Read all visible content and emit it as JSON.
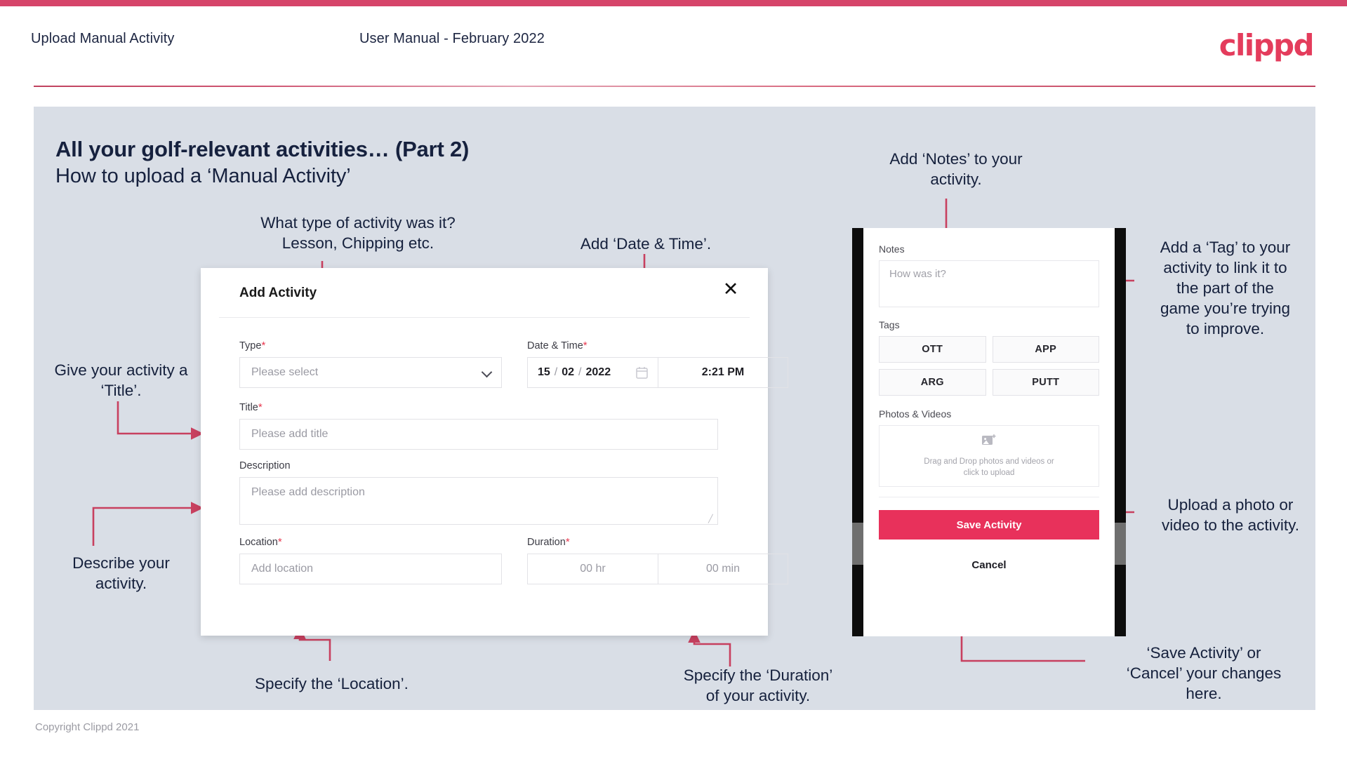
{
  "header": {
    "title": "Upload Manual Activity",
    "subtitle": "User Manual - February 2022",
    "logo": "clippd"
  },
  "slide": {
    "heading": "All your golf-relevant activities… (Part 2)",
    "subheading": "How to upload a ‘Manual Activity’"
  },
  "annotations": {
    "type": "What type of activity was it?\nLesson, Chipping etc.",
    "datetime": "Add ‘Date & Time’.",
    "title": "Give your activity a\n‘Title’.",
    "description": "Describe your\nactivity.",
    "location": "Specify the ‘Location’.",
    "duration": "Specify the ‘Duration’\nof your activity.",
    "notes": "Add ‘Notes’ to your\nactivity.",
    "tag": "Add a ‘Tag’ to your\nactivity to link it to\nthe part of the\ngame you’re trying\nto improve.",
    "upload": "Upload a photo or\nvideo to the activity.",
    "save": "‘Save Activity’ or\n‘Cancel’ your changes\nhere."
  },
  "dialog": {
    "title": "Add Activity",
    "close_icon": "close-icon",
    "type": {
      "label": "Type",
      "required": "*",
      "placeholder": "Please select",
      "chevron_icon": "chevron-down-icon"
    },
    "datetime": {
      "label": "Date & Time",
      "required": "*",
      "day": "15",
      "month": "02",
      "year": "2022",
      "sep": "/",
      "calendar_icon": "calendar-icon",
      "time": "2:21 PM"
    },
    "title_field": {
      "label": "Title",
      "required": "*",
      "placeholder": "Please add title"
    },
    "description": {
      "label": "Description",
      "placeholder": "Please add description"
    },
    "location": {
      "label": "Location",
      "required": "*",
      "placeholder": "Add location"
    },
    "duration": {
      "label": "Duration",
      "required": "*",
      "hours_placeholder": "00 hr",
      "minutes_placeholder": "00 min"
    }
  },
  "phone": {
    "notes_label": "Notes",
    "notes_placeholder": "How was it?",
    "tags_label": "Tags",
    "tags": [
      "OTT",
      "APP",
      "ARG",
      "PUTT"
    ],
    "photos_label": "Photos & Videos",
    "dropzone_icon": "add-image-icon",
    "dropzone_text": "Drag and Drop photos and videos or\nclick to upload",
    "save_label": "Save Activity",
    "cancel_label": "Cancel"
  },
  "footer": {
    "copyright": "Copyright Clippd 2021"
  },
  "colors": {
    "brand": "#e43c5c",
    "accent_bar": "#d6456a",
    "slide_bg": "#d9dee6",
    "arrow": "#c8405f",
    "save_btn": "#e8315b",
    "text_dark": "#16213e"
  }
}
